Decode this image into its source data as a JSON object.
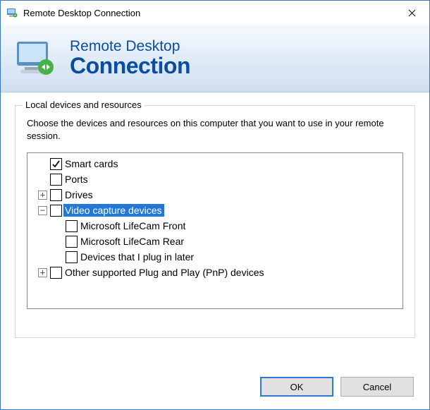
{
  "titlebar": {
    "title": "Remote Desktop Connection"
  },
  "banner": {
    "line1": "Remote Desktop",
    "line2": "Connection"
  },
  "group": {
    "legend": "Local devices and resources",
    "description": "Choose the devices and resources on this computer that you want to use in your remote session."
  },
  "tree": {
    "items": [
      {
        "label": "Smart cards",
        "checked": true,
        "expander": null,
        "depth": 0,
        "selected": false
      },
      {
        "label": "Ports",
        "checked": false,
        "expander": null,
        "depth": 0,
        "selected": false
      },
      {
        "label": "Drives",
        "checked": false,
        "expander": "plus",
        "depth": 0,
        "selected": false
      },
      {
        "label": "Video capture devices",
        "checked": false,
        "expander": "minus",
        "depth": 0,
        "selected": true
      },
      {
        "label": "Microsoft LifeCam Front",
        "checked": false,
        "expander": null,
        "depth": 1,
        "selected": false
      },
      {
        "label": "Microsoft LifeCam Rear",
        "checked": false,
        "expander": null,
        "depth": 1,
        "selected": false
      },
      {
        "label": "Devices that I plug in later",
        "checked": false,
        "expander": null,
        "depth": 1,
        "selected": false
      },
      {
        "label": "Other supported Plug and Play (PnP) devices",
        "checked": false,
        "expander": "plus",
        "depth": 0,
        "selected": false
      }
    ]
  },
  "buttons": {
    "ok": "OK",
    "cancel": "Cancel"
  },
  "glyphs": {
    "plus": "+",
    "minus": "−"
  }
}
